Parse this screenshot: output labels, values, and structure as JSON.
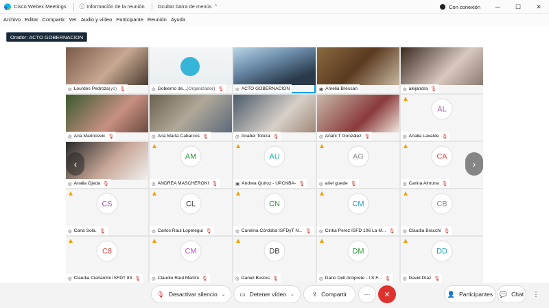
{
  "titlebar": {
    "app_name": "Cisco Webex Meetings",
    "meeting_info": "Información de la reunión",
    "hide_menu": "Ocultar barra de menús",
    "connection_status": "Con conexión"
  },
  "menu": [
    "Archivo",
    "Editar",
    "Compartir",
    "Ver",
    "Audio y vídeo",
    "Participante",
    "Reunión",
    "Ayuda"
  ],
  "speaker": {
    "label": "Orador: ACTO GOBERNACION"
  },
  "colors": {
    "accent": "#00a0e4",
    "mute_red": "#d0312d",
    "end_red": "#e0322d",
    "warning": "#f0a000"
  },
  "tiles": [
    {
      "name": "Lourdes Pedroza",
      "suffix": " (yo)",
      "initials": "",
      "muted": true
    },
    {
      "name": "Gobierno de...",
      "suffix": " (Organizador)",
      "initials": "",
      "muted": true
    },
    {
      "name": "ACTO GOBERNACION",
      "suffix": "",
      "initials": "",
      "muted": false
    },
    {
      "name": "Amelia Bressan",
      "suffix": "",
      "initials": "",
      "muted": false
    },
    {
      "name": "alejandra",
      "suffix": "",
      "initials": "",
      "muted": true
    },
    {
      "name": "Ana Marincevic",
      "suffix": "",
      "initials": "",
      "muted": true
    },
    {
      "name": "Ana Marta Cabarcos",
      "suffix": "",
      "initials": "",
      "muted": true
    },
    {
      "name": "Anabel Toloza",
      "suffix": "",
      "initials": "",
      "muted": true
    },
    {
      "name": "Anahi T González",
      "suffix": "",
      "initials": "",
      "muted": true
    },
    {
      "name": "Analia Laxalde",
      "suffix": "",
      "initials": "AL",
      "muted": true
    },
    {
      "name": "Analia Ojeda",
      "suffix": "",
      "initials": "",
      "muted": true
    },
    {
      "name": "ANDREA MASCHERONI",
      "suffix": "",
      "initials": "AM",
      "muted": true
    },
    {
      "name": "Andrea Quiroz - UPCNBA-",
      "suffix": "",
      "initials": "AU",
      "muted": true
    },
    {
      "name": "ariel guede",
      "suffix": "",
      "initials": "AG",
      "muted": true
    },
    {
      "name": "Carina Almuna",
      "suffix": "",
      "initials": "CA",
      "muted": true
    },
    {
      "name": "Carla Sola.",
      "suffix": "",
      "initials": "CS",
      "muted": true
    },
    {
      "name": "Carlos Raul Lopetegui",
      "suffix": "",
      "initials": "CL",
      "muted": true
    },
    {
      "name": "Carolina Córdoba ISFDyT N...",
      "suffix": "",
      "initials": "CN",
      "muted": true
    },
    {
      "name": "Cintia Perez ISFD 106 La M...",
      "suffix": "",
      "initials": "CM",
      "muted": true
    },
    {
      "name": "Claudia Bracchi",
      "suffix": "",
      "initials": "CB",
      "muted": true
    },
    {
      "name": "Claudia Ciarlantini ISFDT 83",
      "suffix": "",
      "initials": "C8",
      "muted": true
    },
    {
      "name": "Claudio Raul Martini",
      "suffix": "",
      "initials": "CM",
      "muted": true
    },
    {
      "name": "Daniel Bustos",
      "suffix": "",
      "initials": "DB",
      "muted": true
    },
    {
      "name": "Dario Dell Arciprete - I.S.F...",
      "suffix": "",
      "initials": "DM",
      "muted": true
    },
    {
      "name": "David Díaz",
      "suffix": "",
      "initials": "DD",
      "muted": true
    }
  ],
  "controls": {
    "mute": "Desactivar silencio",
    "video": "Detener vídeo",
    "share": "Compartir",
    "more": "···",
    "participants": "Participantes",
    "chat": "Chat"
  }
}
